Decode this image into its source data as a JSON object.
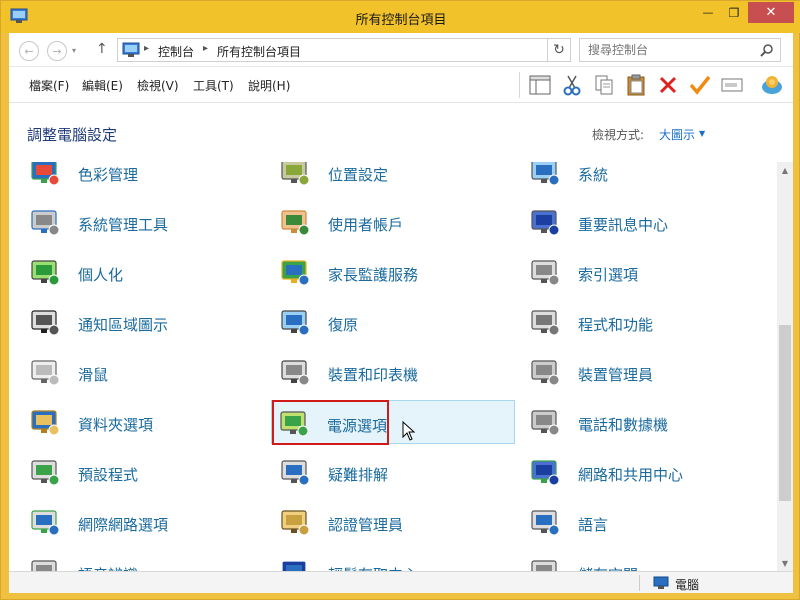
{
  "window": {
    "title": "所有控制台項目",
    "minimize_glyph": "—",
    "maximize_glyph": "❐",
    "close_glyph": "✕"
  },
  "nav": {
    "back_glyph": "←",
    "forward_glyph": "→",
    "recent_glyph": "▾",
    "up_glyph": "↑",
    "refresh_glyph": "↻"
  },
  "address": {
    "crumbs": [
      "控制台",
      "所有控制台項目"
    ],
    "separator": "▸"
  },
  "search": {
    "placeholder": "搜尋控制台"
  },
  "menu": {
    "items": [
      "檔案(F)",
      "編輯(E)",
      "檢視(V)",
      "工具(T)",
      "說明(H)"
    ]
  },
  "toolbar": {
    "icons": [
      "layout-icon",
      "cut-icon",
      "copy-icon",
      "paste-icon",
      "delete-icon",
      "properties-check-icon",
      "rename-icon",
      "internet-options-icon"
    ]
  },
  "header": {
    "title": "調整電腦設定",
    "view_label": "檢視方式:",
    "view_value": "大圖示",
    "view_arrow": "▼"
  },
  "items": [
    {
      "label": "色彩管理",
      "icon": "color-management-icon",
      "col": 0,
      "row": 0
    },
    {
      "label": "位置設定",
      "icon": "location-settings-icon",
      "col": 1,
      "row": 0
    },
    {
      "label": "系統",
      "icon": "system-icon",
      "col": 2,
      "row": 0
    },
    {
      "label": "系統管理工具",
      "icon": "admin-tools-icon",
      "col": 0,
      "row": 1
    },
    {
      "label": "使用者帳戶",
      "icon": "user-accounts-icon",
      "col": 1,
      "row": 1
    },
    {
      "label": "重要訊息中心",
      "icon": "action-center-flag-icon",
      "col": 2,
      "row": 1
    },
    {
      "label": "個人化",
      "icon": "personalization-icon",
      "col": 0,
      "row": 2
    },
    {
      "label": "家長監護服務",
      "icon": "family-safety-icon",
      "col": 1,
      "row": 2
    },
    {
      "label": "索引選項",
      "icon": "indexing-options-icon",
      "col": 2,
      "row": 2
    },
    {
      "label": "通知區域圖示",
      "icon": "notification-area-icon",
      "col": 0,
      "row": 3
    },
    {
      "label": "復原",
      "icon": "recovery-icon",
      "col": 1,
      "row": 3
    },
    {
      "label": "程式和功能",
      "icon": "programs-features-icon",
      "col": 2,
      "row": 3
    },
    {
      "label": "滑鼠",
      "icon": "mouse-icon",
      "col": 0,
      "row": 4
    },
    {
      "label": "裝置和印表機",
      "icon": "devices-printers-icon",
      "col": 1,
      "row": 4
    },
    {
      "label": "裝置管理員",
      "icon": "device-manager-icon",
      "col": 2,
      "row": 4
    },
    {
      "label": "資料夾選項",
      "icon": "folder-options-icon",
      "col": 0,
      "row": 5
    },
    {
      "label": "電源選項",
      "icon": "power-options-icon",
      "col": 1,
      "row": 5
    },
    {
      "label": "電話和數據機",
      "icon": "phone-modem-icon",
      "col": 2,
      "row": 5
    },
    {
      "label": "預設程式",
      "icon": "default-programs-icon",
      "col": 0,
      "row": 6
    },
    {
      "label": "疑難排解",
      "icon": "troubleshooting-icon",
      "col": 1,
      "row": 6
    },
    {
      "label": "網路和共用中心",
      "icon": "network-sharing-icon",
      "col": 2,
      "row": 6
    },
    {
      "label": "網際網路選項",
      "icon": "internet-options-globe-icon",
      "col": 0,
      "row": 7
    },
    {
      "label": "認證管理員",
      "icon": "credential-manager-icon",
      "col": 1,
      "row": 7
    },
    {
      "label": "語言",
      "icon": "language-icon",
      "col": 2,
      "row": 7
    },
    {
      "label": "語音辨識",
      "icon": "speech-recognition-icon",
      "col": 0,
      "row": 8
    },
    {
      "label": "輕鬆存取中心",
      "icon": "ease-of-access-icon",
      "col": 1,
      "row": 8
    },
    {
      "label": "儲存空間",
      "icon": "storage-spaces-icon",
      "col": 2,
      "row": 8
    }
  ],
  "hovered_item": "電源選項",
  "status": {
    "text": "電腦"
  }
}
